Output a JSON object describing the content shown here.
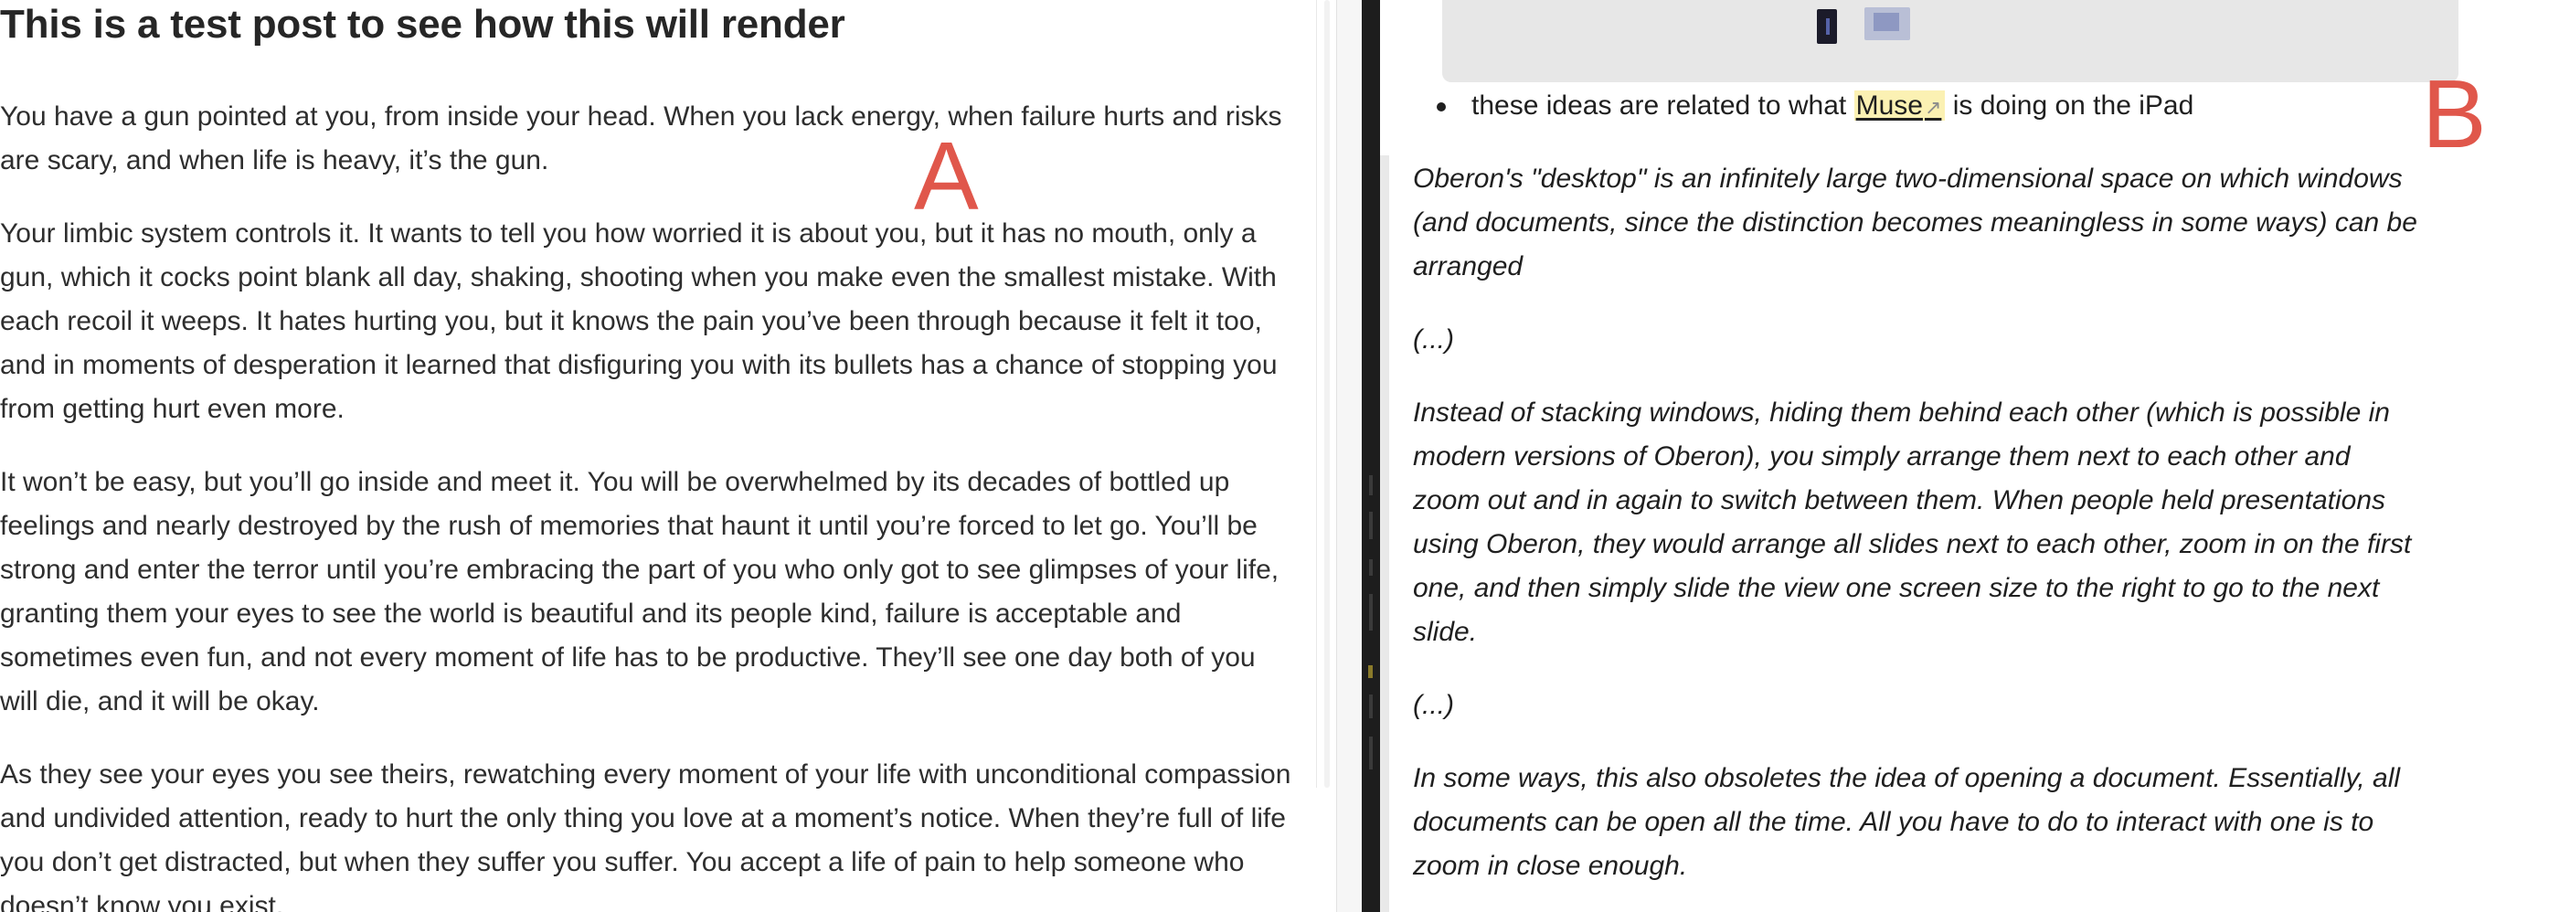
{
  "left_pane": {
    "title": "This is a test post to see how this will render",
    "paragraphs": [
      "You have a gun pointed at you, from inside your head. When you lack energy, when failure hurts and risks are scary, and when life is heavy, it’s the gun.",
      "Your limbic system controls it. It wants to tell you how worried it is about you, but it has no mouth, only a gun, which it cocks point blank all day, shaking, shooting when you make even the smallest mistake. With each recoil it weeps. It hates hurting you, but it knows the pain you’ve been through because it felt it too, and in moments of desperation it learned that disfiguring you with its bullets has a chance of stopping you from getting hurt even more.",
      "It won’t be easy, but you’ll go inside and meet it. You will be overwhelmed by its decades of bottled up feelings and nearly destroyed by the rush of memories that haunt it until you’re forced to let go. You’ll be strong and enter the terror until you’re embracing the part of you who only got to see glimpses of your life, granting them your eyes to see the world is beautiful and its people kind, failure is acceptable and sometimes even fun, and not every moment of life has to be productive. They’ll see one day both of you will die, and it will be okay.",
      "As they see your eyes you see theirs, rewatching every moment of your life with unconditional compassion and undivided attention, ready to hurt the only thing you love at a moment’s notice. When they’re full of life you don’t get distracted, but when they suffer you suffer. You accept a life of pain to help someone who doesn’t know you exist."
    ],
    "marker": "A"
  },
  "right_pane": {
    "bullet": {
      "before": "these ideas are related to what ",
      "link_text": "Muse",
      "link_icon": "external-link-arrow-icon",
      "after": " is doing on the iPad"
    },
    "quote_paragraphs": [
      "Oberon's \"desktop\" is an infinitely large two-dimensional space on which windows (and documents, since the distinction becomes meaningless in some ways) can be arranged",
      "(...)",
      "Instead of stacking windows, hiding them behind each other (which is possible in modern versions of Oberon), you simply arrange them next to each other and zoom out and in again to switch between them. When people held presentations using Oberon, they would arrange all slides next to each other, zoom in on the first one, and then simply slide the view one screen size to the right to go to the next slide.",
      "(...)",
      "In some ways, this also obsoletes the idea of opening a document. Essentially, all documents can be open all the time. All you have to do to interact with one is to zoom in close enough."
    ],
    "marker": "B"
  },
  "colors": {
    "marker": "#e0574b",
    "link_highlight": "#fbf1b3",
    "gutter": "#1d1d1d",
    "quote_bar": "#e9e9e9"
  }
}
